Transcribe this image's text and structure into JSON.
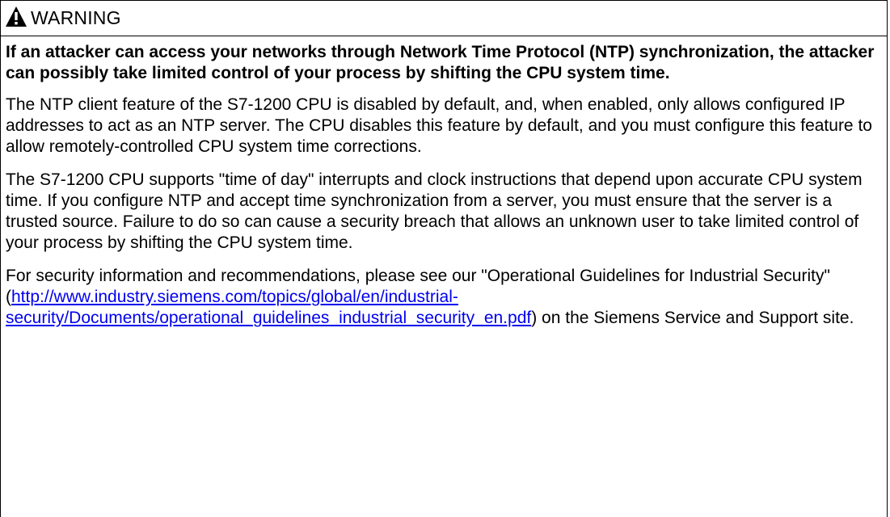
{
  "notice": {
    "icon": "warning-triangle-icon",
    "header": "WARNING",
    "lead": "If an attacker can access your networks through Network Time Protocol (NTP) synchronization, the attacker can possibly take limited control of your process by shifting the CPU system time.",
    "paragraphs": [
      "The NTP client feature of the S7-1200 CPU is disabled by default, and, when enabled, only allows configured IP addresses to act as an NTP server. The CPU disables this feature by default, and you must configure this feature to allow remotely-controlled CPU system time corrections.",
      "The S7-1200 CPU supports \"time of day\" interrupts and clock instructions that depend upon accurate CPU system time. If you configure NTP and accept time synchronization from a server, you must ensure that the server is a trusted source. Failure to do so can cause a security breach that allows an unknown user to take limited control of your process by shifting the CPU system time."
    ],
    "security_info": {
      "before": "For security information and recommendations, please see our \"Operational Guidelines for Industrial Security\" (",
      "link": "http://www.industry.siemens.com/topics/global/en/industrial-security/Documents/operational_guidelines_industrial_security_en.pdf",
      "after": ") on the Siemens Service and Support site."
    },
    "colors": {
      "text": "#000000",
      "link": "#0000ee",
      "border": "#000000"
    }
  }
}
